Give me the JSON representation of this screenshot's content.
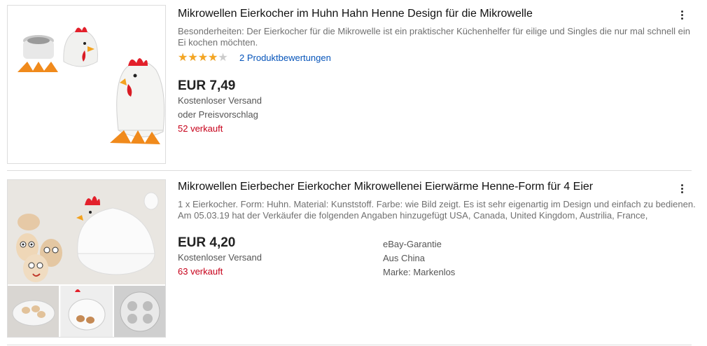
{
  "listings": [
    {
      "title": "Mikrowellen Eierkocher im Huhn Hahn Henne Design für die Mikrowelle",
      "subtitle": "Besonderheiten: Der Eierkocher für die Mikrowelle ist ein praktischer Küchenhelfer für eilige und Singles die nur mal schnell ein Ei kochen möchten.",
      "rating": 3.5,
      "rating_max": 5,
      "reviews": "2 Produktbewertungen",
      "price": "EUR 7,49",
      "shipping": "Kostenloser Versand",
      "offer": "oder Preisvorschlag",
      "sold": "52 verkauft",
      "image_icon": "hen-egg-cooker-icon"
    },
    {
      "title": "Mikrowellen Eierbecher Eierkocher Mikrowellenei Eierwärme Henne-Form für 4 Eier",
      "subtitle": "1 x Eierkocher. Form: Huhn. Material: Kunststoff. Farbe: wie Bild zeigt. Es ist sehr eigenartig im Design und einfach zu bedienen. Am 05.03.19 hat der Verkäufer die folgenden Angaben hinzugefügt USA, Canada, United Kingdom, Austrilia, France,",
      "price": "EUR 4,20",
      "shipping": "Kostenloser Versand",
      "sold": "63 verkauft",
      "guarantee": "eBay-Garantie",
      "origin": "Aus China",
      "brand": "Marke: Markenlos",
      "image_icon": "hen-egg-cooker-collage-icon"
    }
  ],
  "colors": {
    "title": "#111111",
    "subtitle": "#707070",
    "link": "#0654ba",
    "sold": "#c7001a",
    "star": "#f5a623",
    "star_empty": "#cccccc",
    "divider": "#dddddd"
  }
}
